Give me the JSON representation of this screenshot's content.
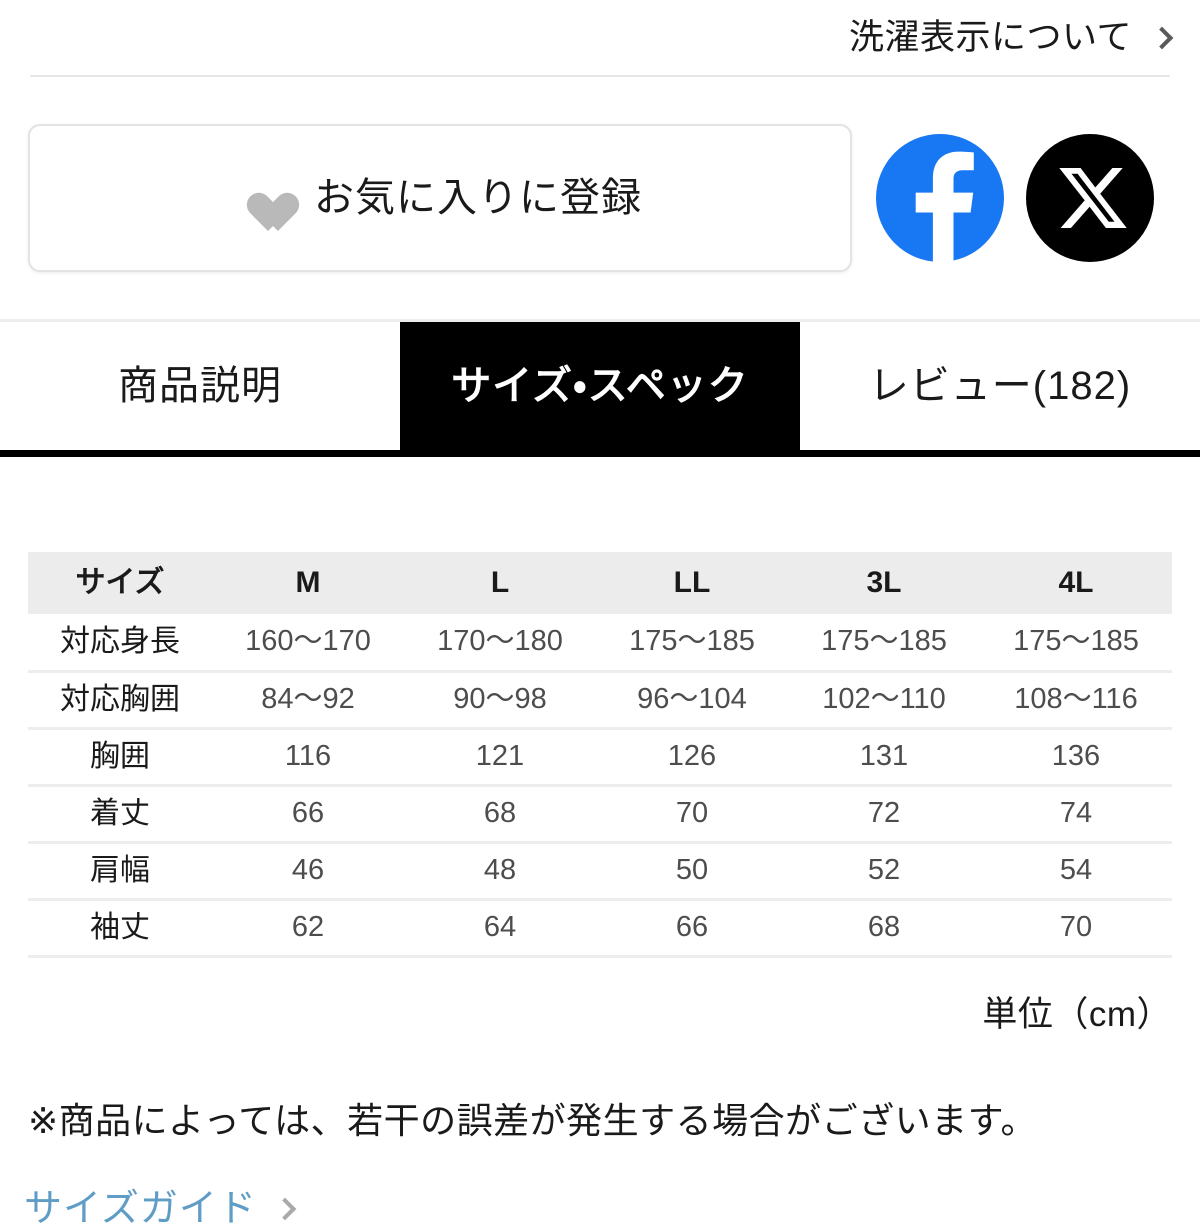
{
  "care_label_link": {
    "label": "洗濯表示について",
    "chevron_icon": "chevron-right-icon"
  },
  "favorite": {
    "label": "お気に入りに登録",
    "heart_icon": "heart-icon",
    "heart_color": "#b9b9b9"
  },
  "social": [
    {
      "name": "facebook",
      "icon": "facebook-icon",
      "color": "#1877F2"
    },
    {
      "name": "x-twitter",
      "icon": "x-icon",
      "color": "#000000"
    }
  ],
  "tabs": [
    {
      "label": "商品説明",
      "active": false
    },
    {
      "label": "サイズ・スペック",
      "active": true
    },
    {
      "label": "レビュー(182)",
      "active": false
    }
  ],
  "size_table": {
    "columns": [
      "サイズ",
      "M",
      "L",
      "LL",
      "3L",
      "4L"
    ],
    "rows": [
      {
        "label": "対応身長",
        "values": [
          "160〜170",
          "170〜180",
          "175〜185",
          "175〜185",
          "175〜185"
        ]
      },
      {
        "label": "対応胸囲",
        "values": [
          "84〜92",
          "90〜98",
          "96〜104",
          "102〜110",
          "108〜116"
        ]
      },
      {
        "label": "胸囲",
        "values": [
          "116",
          "121",
          "126",
          "131",
          "136"
        ]
      },
      {
        "label": "着丈",
        "values": [
          "66",
          "68",
          "70",
          "72",
          "74"
        ]
      },
      {
        "label": "肩幅",
        "values": [
          "46",
          "48",
          "50",
          "52",
          "54"
        ]
      },
      {
        "label": "袖丈",
        "values": [
          "62",
          "64",
          "66",
          "68",
          "70"
        ]
      }
    ],
    "unit_note": "単位（cm）"
  },
  "disclaimer": "※商品によっては、若干の誤差が発生する場合がございます。",
  "size_guide_link": {
    "label": "サイズガイド",
    "color": "#5f9dc6",
    "chevron_icon": "chevron-right-icon"
  }
}
